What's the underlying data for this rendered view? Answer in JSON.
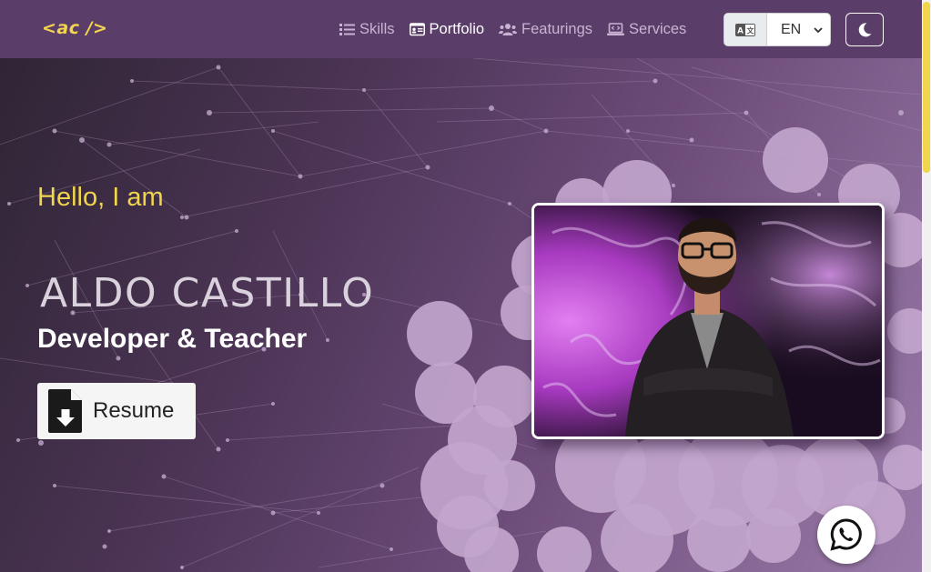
{
  "brand": {
    "logo_text": "<ac />"
  },
  "nav": {
    "items": [
      {
        "label": "Skills",
        "icon": "list-icon",
        "active": false
      },
      {
        "label": "Portfolio",
        "icon": "id-card-icon",
        "active": true
      },
      {
        "label": "Featurings",
        "icon": "users-icon",
        "active": false
      },
      {
        "label": "Services",
        "icon": "laptop-code-icon",
        "active": false
      }
    ],
    "language": {
      "icon": "translate-icon",
      "selected": "EN"
    },
    "theme_toggle": {
      "icon": "moon-icon"
    }
  },
  "hero": {
    "greeting": "Hello, I am",
    "name": "ALDO CASTILLO",
    "role": "Developer & Teacher",
    "resume_label": "Resume",
    "resume_icon": "file-download-icon",
    "photo_alt": "profile-photo"
  },
  "floating": {
    "whatsapp_icon": "whatsapp-icon"
  },
  "colors": {
    "navbar": "#5a3d68",
    "accent_yellow": "#f0d54d",
    "hero_dark": "#2f2535",
    "hero_light": "#9a7aa8",
    "blob": "#c2a5cc"
  }
}
